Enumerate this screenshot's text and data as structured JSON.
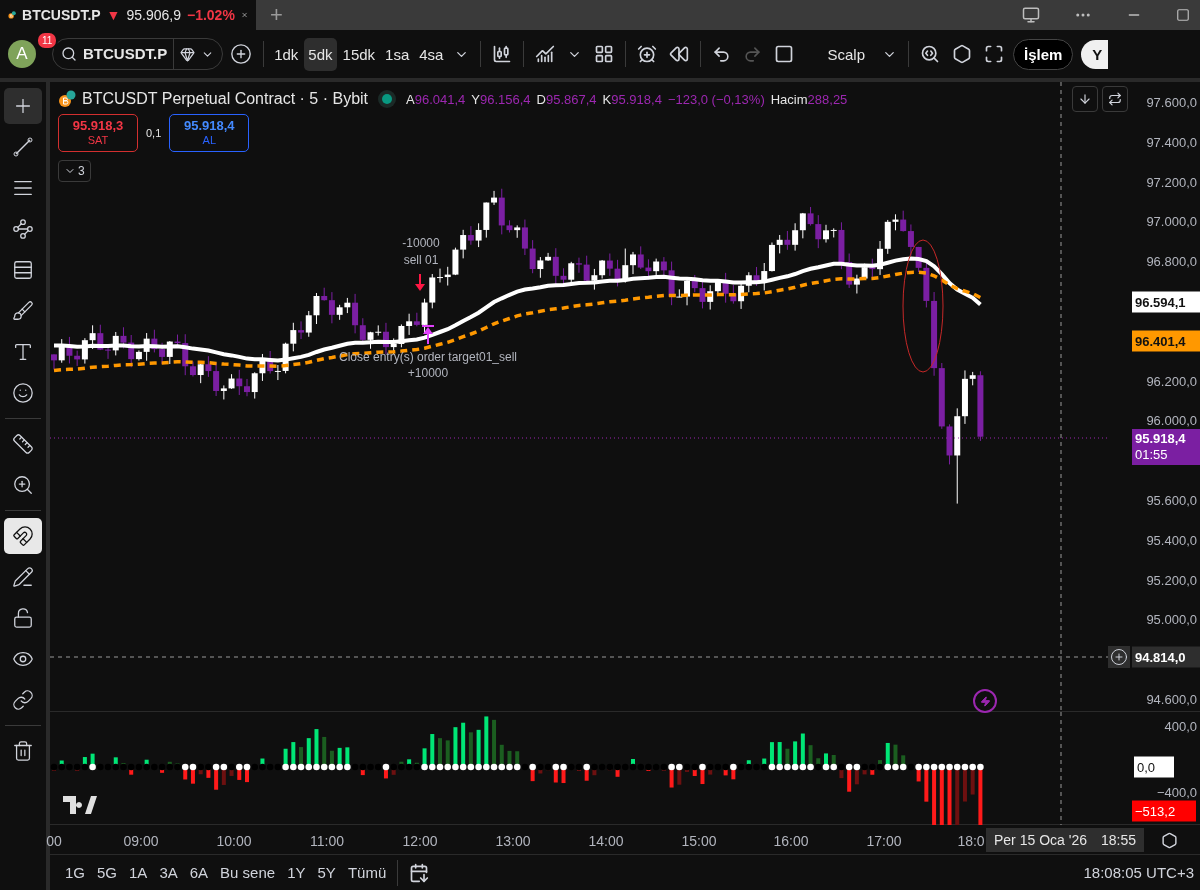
{
  "tab": {
    "symbol": "BTCUSDT.P",
    "direction": "▼",
    "price": "95.906,9",
    "change": "−1.02%"
  },
  "new_tab": "+",
  "toolbar": {
    "avatar": "A",
    "notifications": "11",
    "symbol": "BTCUSDT.P",
    "intervals": [
      {
        "label": "1dk",
        "selected": false
      },
      {
        "label": "5dk",
        "selected": true
      },
      {
        "label": "15dk",
        "selected": false
      },
      {
        "label": "1sa",
        "selected": false
      },
      {
        "label": "4sa",
        "selected": false
      }
    ],
    "redo_disabled": true,
    "layout_name": "Scalp",
    "trade_button": "İşlem",
    "profile": "Y"
  },
  "left_tools": [
    {
      "kind": "crosshair",
      "selected": true
    },
    {
      "kind": "trend",
      "selected": false
    },
    {
      "kind": "fib",
      "selected": false
    },
    {
      "kind": "pattern",
      "selected": false
    },
    {
      "kind": "projection",
      "selected": false
    },
    {
      "kind": "brush",
      "selected": false
    },
    {
      "kind": "text",
      "selected": false
    },
    {
      "kind": "emoji",
      "selected": false
    },
    {
      "kind": "ruler",
      "selected": false
    },
    {
      "kind": "zoom",
      "selected": false
    },
    {
      "kind": "magnet",
      "selected": true
    },
    {
      "kind": "drawlock",
      "selected": false
    },
    {
      "kind": "lock",
      "selected": false
    },
    {
      "kind": "eye",
      "selected": false
    },
    {
      "kind": "link",
      "selected": false
    },
    {
      "kind": "trash",
      "selected": false
    }
  ],
  "legend": {
    "title": "BTCUSDT Perpetual Contract · 5 · Bybit",
    "ohlc": [
      {
        "key": "A",
        "value": "96.041,4"
      },
      {
        "key": "Y",
        "value": "96.156,4"
      },
      {
        "key": "D",
        "value": "95.867,4"
      },
      {
        "key": "K",
        "value": "95.918,4"
      }
    ],
    "change": "−123,0 (−0,13%)",
    "volume_label": "Hacim",
    "volume": "288,25"
  },
  "order_panel": {
    "sell_price": "95.918,3",
    "sell_label": "SAT",
    "spread": "0,1",
    "buy_price": "95.918,4",
    "buy_label": "AL"
  },
  "indicators_toggle": {
    "count": "3"
  },
  "trade_marks": [
    {
      "kind": "entry",
      "qty": "-10000",
      "label": "sell 01"
    },
    {
      "kind": "exit",
      "label": "Close entry(s) order target01_sell",
      "qty": "+10000"
    }
  ],
  "price_axis": {
    "ticks": [
      "97.600,0",
      "97.400,0",
      "97.200,0",
      "97.000,0",
      "96.800,0",
      "96.200,0",
      "96.000,0",
      "95.600,0",
      "95.400,0",
      "95.200,0",
      "95.000,0",
      "94.600,0"
    ],
    "ma_fast": "96.594,1",
    "ma_slow": "96.401,4",
    "last_price": "95.918,4",
    "countdown": "01:55",
    "crosshair_price": "94.814,0"
  },
  "oscillator_axis": {
    "ticks": [
      "400,0",
      "−400,0"
    ],
    "zero": "0,0",
    "value": "−513,2"
  },
  "time_axis": {
    "ticks": [
      "00",
      "09:00",
      "10:00",
      "11:00",
      "12:00",
      "13:00",
      "14:00",
      "15:00",
      "16:00",
      "17:00",
      "18:0"
    ],
    "crosshair_date": "Per 15 Oca '26",
    "crosshair_time": "18:55"
  },
  "range_bar": {
    "ranges": [
      "1G",
      "5G",
      "1A",
      "3A",
      "6A",
      "Bu sene",
      "1Y",
      "5Y",
      "Tümü"
    ],
    "clock": "18:08:05 UTC+3"
  }
}
